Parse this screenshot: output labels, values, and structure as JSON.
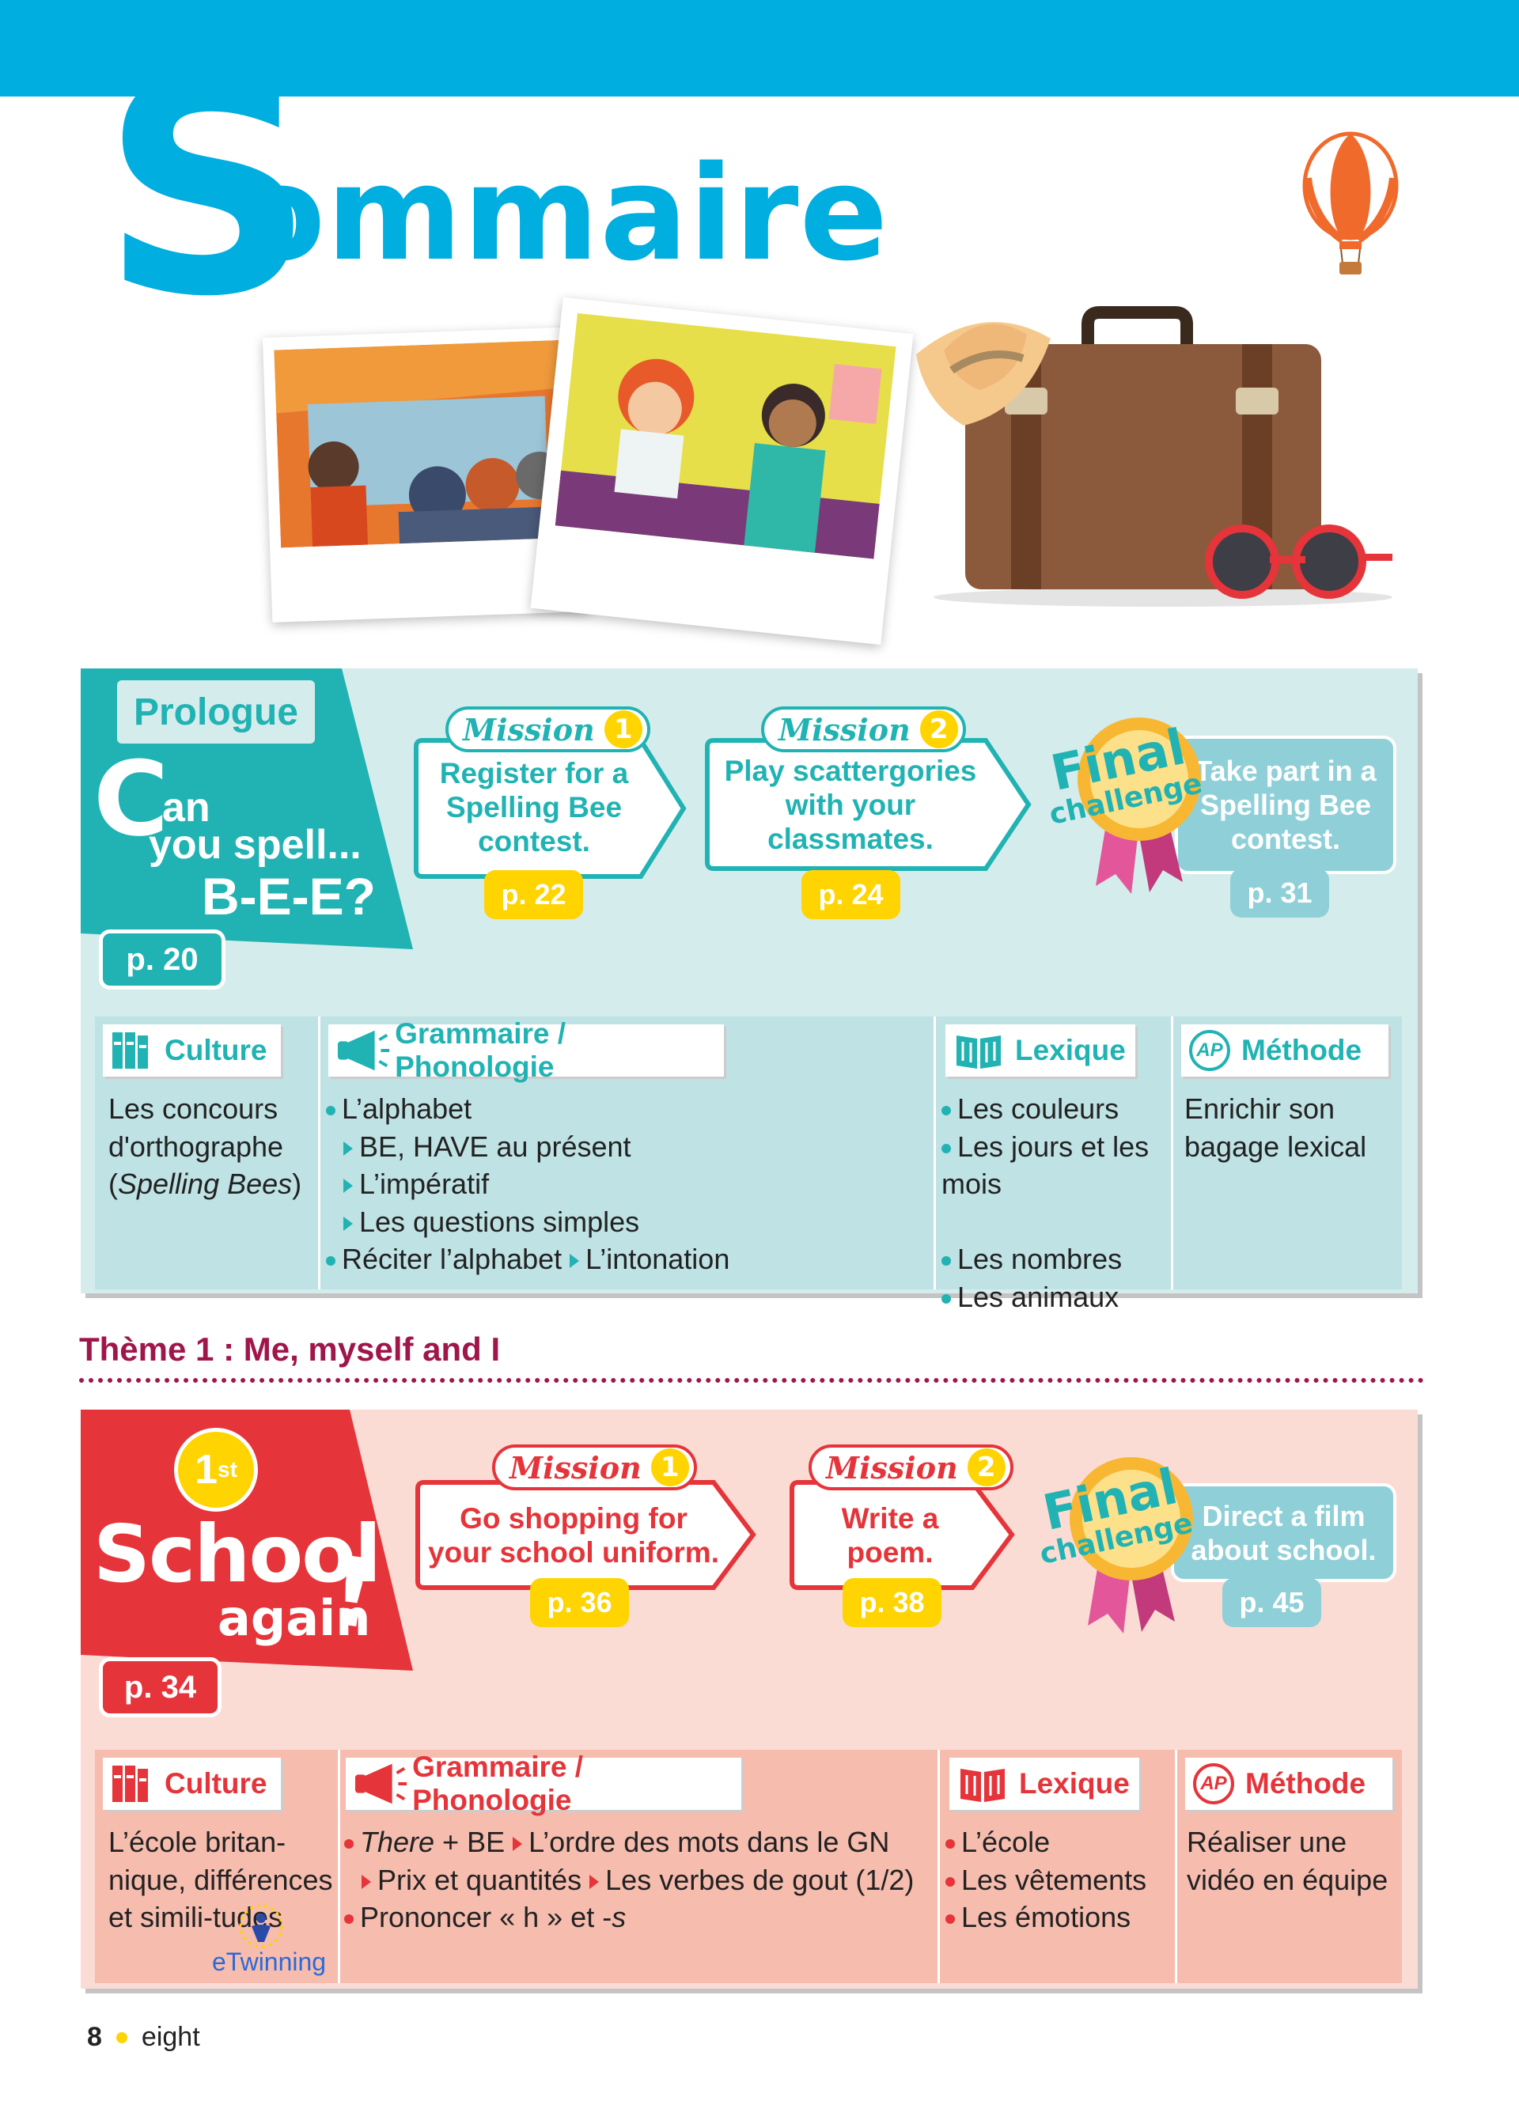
{
  "title": {
    "first_letter": "S",
    "rest": "ommaire"
  },
  "prologue": {
    "label": "Prologue",
    "title_big": "C",
    "title_an": "an",
    "title_line2": "you spell...",
    "title_line3": "B-E-E?",
    "page": "p. 20",
    "mission1": {
      "tag": "Mission",
      "num": "1",
      "text": "Register for a Spelling Bee contest.",
      "page": "p. 22"
    },
    "mission2": {
      "tag": "Mission",
      "num": "2",
      "text": "Play scattergories with your classmates.",
      "page": "p. 24"
    },
    "final": {
      "word1": "Final",
      "word2": "challenge",
      "text": "Take part in a Spelling Bee contest.",
      "page": "p. 31"
    },
    "culture": {
      "header": "Culture",
      "text_a": "Les concours d'orthographe (",
      "text_italic": "Spelling Bees",
      "text_b": ")"
    },
    "grammaire": {
      "header": "Grammaire / Phonologie",
      "line1": "L’alphabet",
      "line2": "BE, HAVE au présent",
      "line3": "L’impératif",
      "line4": "Les questions simples",
      "line5a": "Réciter l’alphabet",
      "line5b": "L’intonation"
    },
    "lexique": {
      "header": "Lexique",
      "items": [
        "Les couleurs",
        "Les jours et les mois",
        "Les nombres",
        "Les animaux"
      ]
    },
    "methode": {
      "header": "Méthode",
      "badge": "AP",
      "text": "Enrichir son bagage lexical"
    }
  },
  "theme1": {
    "label": "Thème 1 : Me, myself and I"
  },
  "unit1": {
    "badge": "1",
    "badge_sup": "st",
    "title_line1": "School",
    "title_line2": "again",
    "title_excl": "!",
    "page": "p. 34",
    "mission1": {
      "tag": "Mission",
      "num": "1",
      "text": "Go shopping for your school uniform.",
      "page": "p. 36"
    },
    "mission2": {
      "tag": "Mission",
      "num": "2",
      "text": "Write a poem.",
      "page": "p. 38"
    },
    "final": {
      "word1": "Final",
      "word2": "challenge",
      "text": "Direct a film about school.",
      "page": "p. 45"
    },
    "culture": {
      "header": "Culture",
      "text": "L’école britan-nique, différences et simili-tudes",
      "twinning": "eTwinning"
    },
    "grammaire": {
      "header": "Grammaire / Phonologie",
      "line1_italic": "There",
      "line1_rest": " + BE",
      "line1b": "L’ordre des mots dans le GN",
      "line2a": "Prix et quantités",
      "line2b": "Les verbes de gout (1/2)",
      "line3a": "Prononcer « h » et -",
      "line3_italic": "s"
    },
    "lexique": {
      "header": "Lexique",
      "items": [
        "L’école",
        "Les vêtements",
        "Les émotions"
      ]
    },
    "methode": {
      "header": "Méthode",
      "badge": "AP",
      "text": "Réaliser une vidéo en équipe"
    }
  },
  "footer": {
    "page_num": "8",
    "page_word": "eight"
  },
  "colors": {
    "cyan": "#00aee0",
    "teal": "#21b3b3",
    "red": "#e5343a",
    "yellow": "#ffd400",
    "maroon": "#a0154a"
  }
}
